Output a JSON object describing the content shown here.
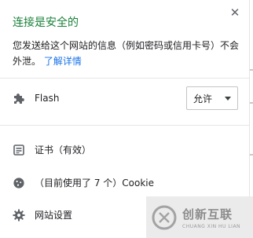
{
  "popup": {
    "title": "连接是安全的",
    "close_glyph": "✕",
    "description": "您发送给这个网站的信息（例如密码或信用卡号）不会外泄。",
    "learn_more_link": "了解详情"
  },
  "permissions": [
    {
      "label": "Flash",
      "icon": "puzzle-piece-icon",
      "value": "允许"
    }
  ],
  "items": [
    {
      "label": "证书（有效）",
      "icon": "certificate-icon"
    },
    {
      "label": "（目前使用了 7 个）Cookie",
      "icon": "cookie-icon"
    },
    {
      "label": "网站设置",
      "icon": "gear-icon"
    }
  ],
  "watermark": {
    "brand": "创新互联",
    "subtitle": "CHUANG XIN HU LIAN"
  },
  "colors": {
    "secure_title": "#188038",
    "link": "#1a73e8"
  }
}
